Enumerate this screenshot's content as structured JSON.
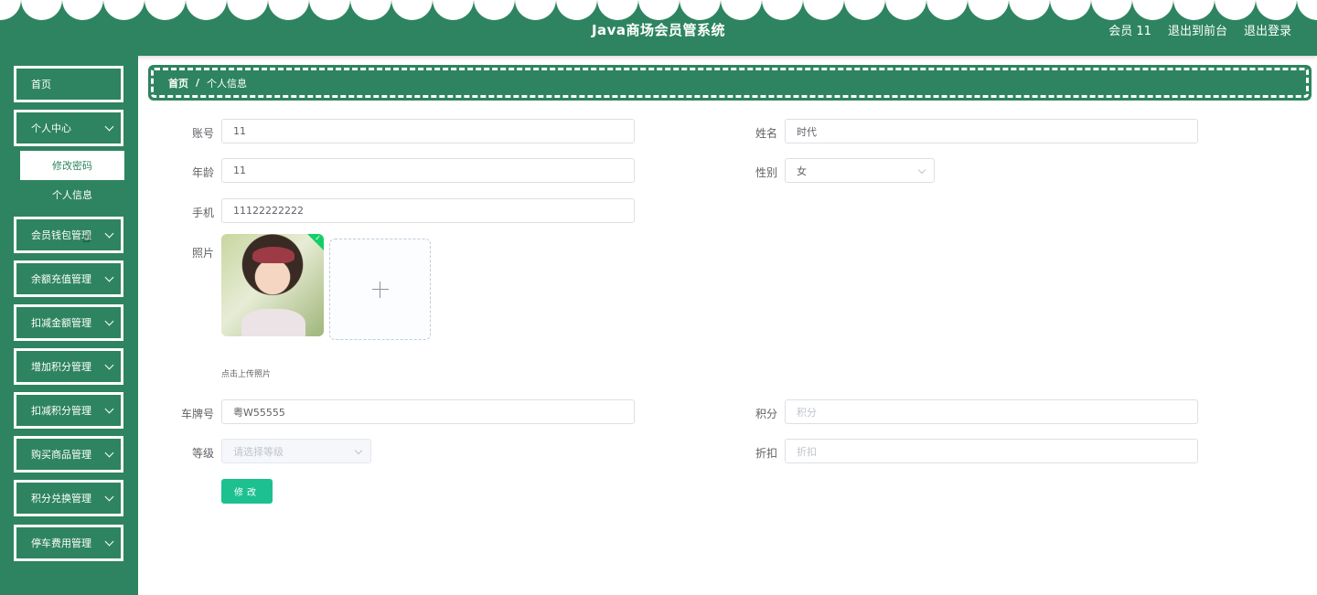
{
  "header": {
    "title": "Java商场会员管系统",
    "user": "会员 11",
    "exit_front": "退出到前台",
    "logout": "退出登录"
  },
  "sidebar": {
    "items": [
      {
        "label": "首页"
      },
      {
        "label": "个人中心"
      },
      {
        "label": "会员钱包管理"
      },
      {
        "label": "余额充值管理"
      },
      {
        "label": "扣减金额管理"
      },
      {
        "label": "增加积分管理"
      },
      {
        "label": "扣减积分管理"
      },
      {
        "label": "购买商品管理"
      },
      {
        "label": "积分兑换管理"
      },
      {
        "label": "停车费用管理"
      }
    ],
    "submenu": [
      {
        "label": "修改密码"
      },
      {
        "label": "个人信息"
      }
    ]
  },
  "breadcrumb": {
    "home": "首页",
    "separator": "/",
    "current": "个人信息"
  },
  "form": {
    "account": {
      "label": "账号",
      "value": "11"
    },
    "name": {
      "label": "姓名",
      "value": "时代"
    },
    "age": {
      "label": "年龄",
      "value": "11"
    },
    "gender": {
      "label": "性别",
      "value": "女"
    },
    "phone": {
      "label": "手机",
      "value": "11122222222"
    },
    "photo": {
      "label": "照片",
      "tip": "点击上传照片"
    },
    "plate": {
      "label": "车牌号",
      "value": "粤W55555"
    },
    "points": {
      "label": "积分",
      "placeholder": "积分"
    },
    "level": {
      "label": "等级",
      "placeholder": "请选择等级"
    },
    "discount": {
      "label": "折扣",
      "placeholder": "折扣"
    },
    "submit": "修改"
  },
  "colors": {
    "primary": "#2e8460",
    "button": "#1dc08f",
    "success": "#13ce66"
  }
}
